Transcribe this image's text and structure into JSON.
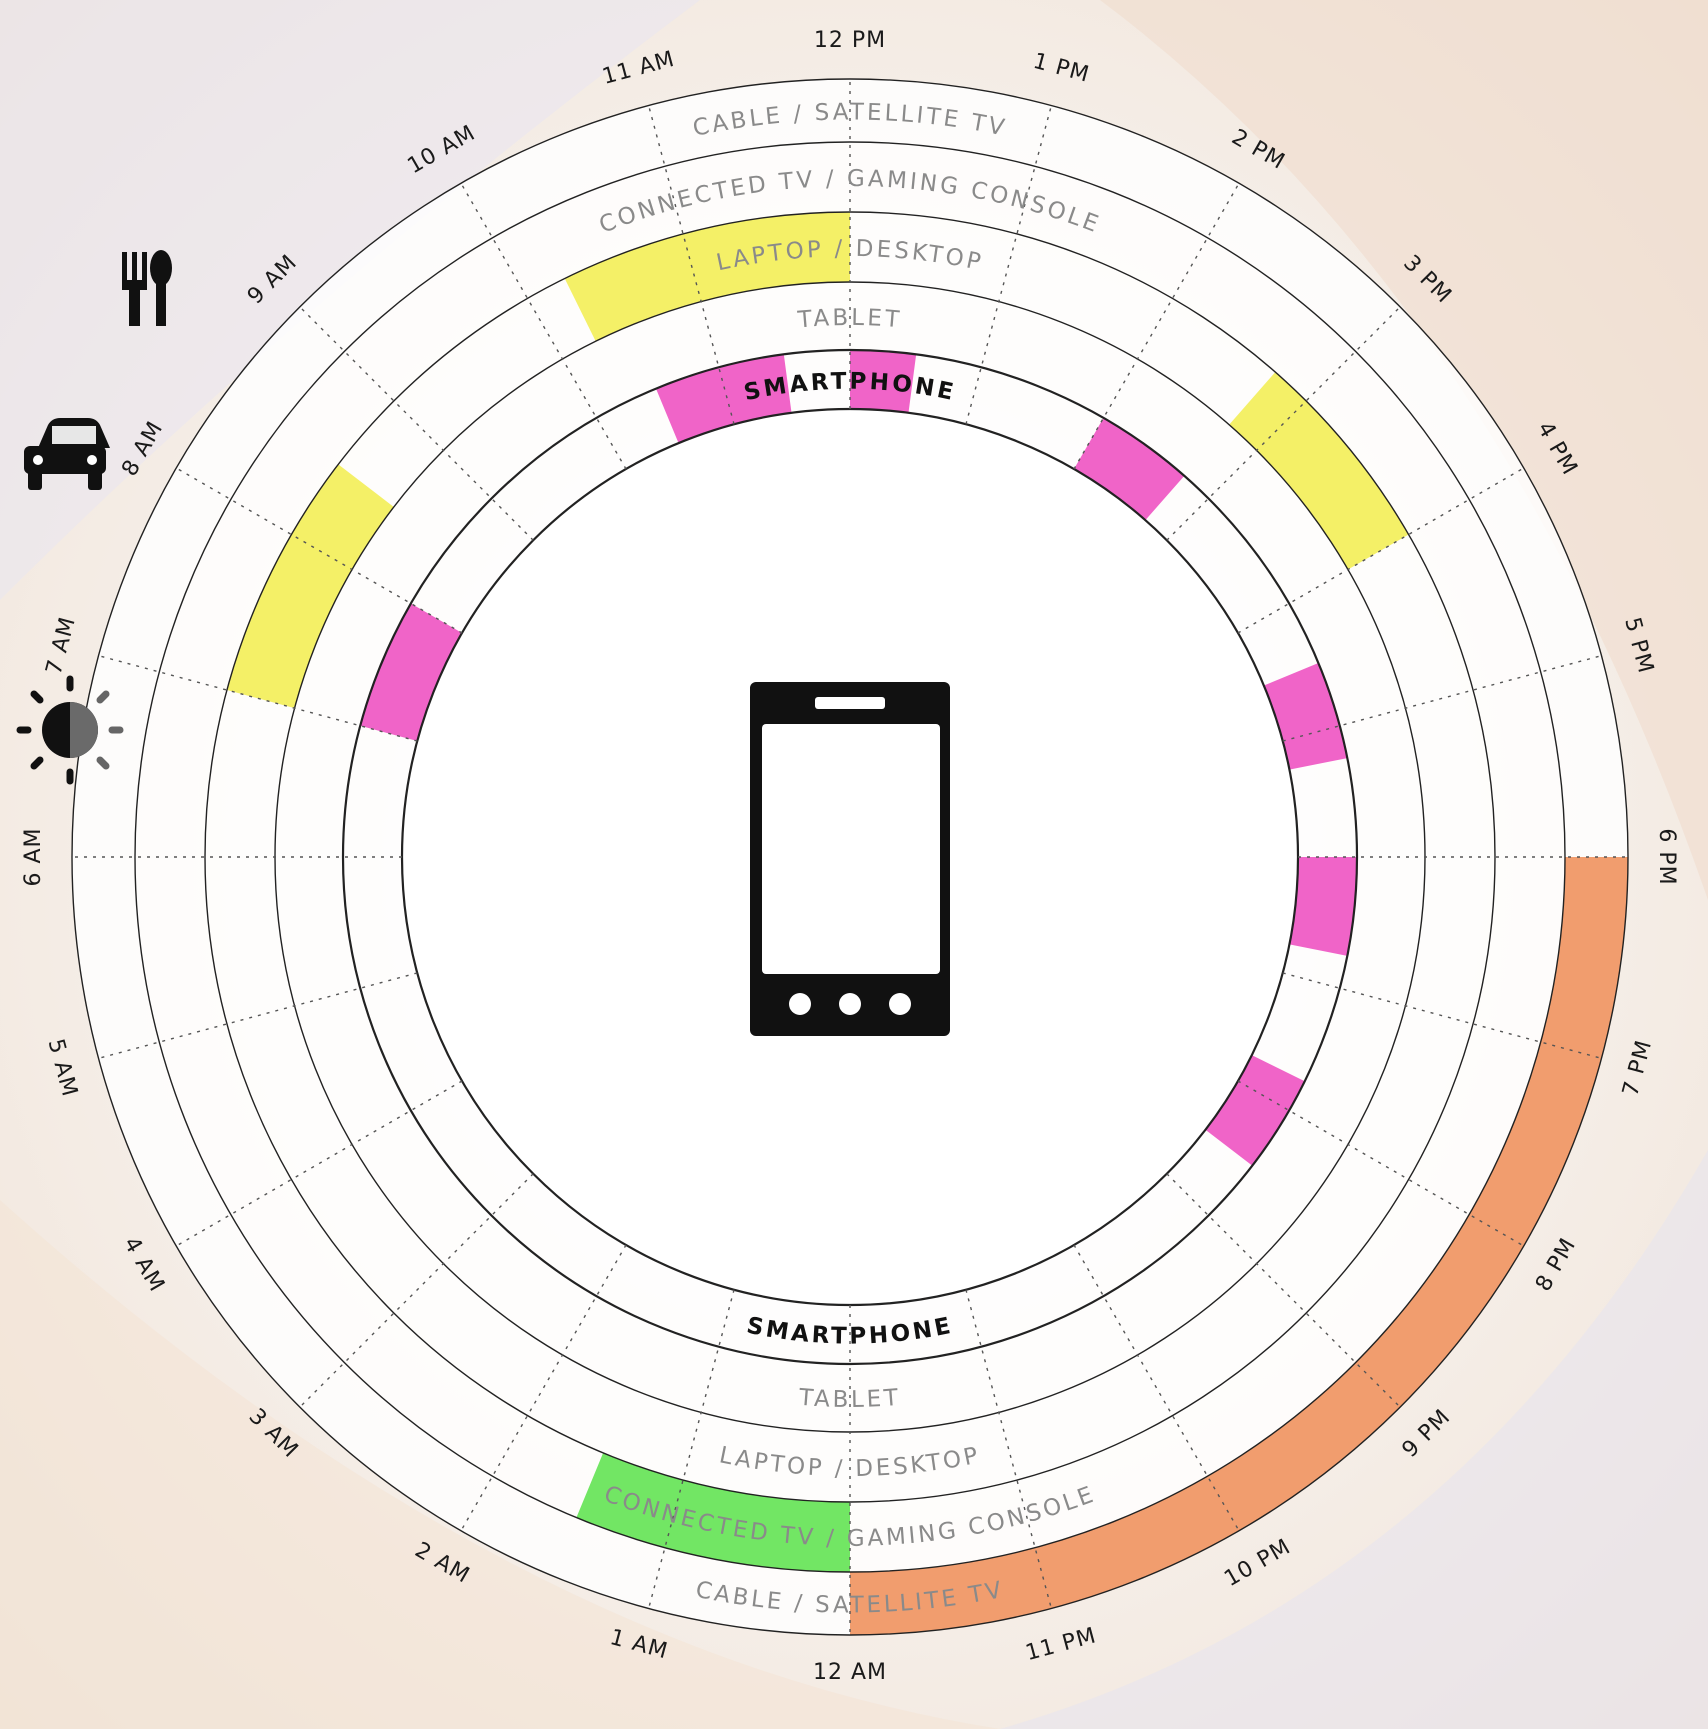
{
  "rings": [
    {
      "key": "cable",
      "label": "CABLE / SATELLITE TV"
    },
    {
      "key": "connected",
      "label": "CONNECTED TV / GAMING CONSOLE"
    },
    {
      "key": "laptop",
      "label": "LAPTOP / DESKTOP"
    },
    {
      "key": "tablet",
      "label": "TABLET"
    },
    {
      "key": "smartphone",
      "label": "SMARTPHONE"
    }
  ],
  "hour_labels": [
    "12 PM",
    "1 PM",
    "2 PM",
    "3 PM",
    "4 PM",
    "5 PM",
    "6 PM",
    "7 PM",
    "8 PM",
    "9 PM",
    "10 PM",
    "11 PM",
    "12 AM",
    "1 AM",
    "2 AM",
    "3 AM",
    "4 AM",
    "5 AM",
    "6 AM",
    "7 AM",
    "8 AM",
    "9 AM",
    "10 AM",
    "11 AM"
  ],
  "center_icon": "smartphone-icon",
  "side_icons": [
    {
      "icon": "fork-spoon-icon",
      "meaning": "meal"
    },
    {
      "icon": "car-icon",
      "meaning": "commute"
    },
    {
      "icon": "sunrise-icon",
      "meaning": "wake up"
    }
  ],
  "colors": {
    "smartphone": "#ee4fc0",
    "laptop": "#f3ee52",
    "connected": "#5ee24f",
    "cable": "#ef8f5a",
    "ring_line": "#222222"
  },
  "usage_blocks": [
    {
      "device": "smartphone",
      "start": "7 AM",
      "end": "8 AM"
    },
    {
      "device": "smartphone",
      "start": "10:30 AM",
      "end": "11:30 AM"
    },
    {
      "device": "smartphone",
      "start": "12 PM",
      "end": "12:30 PM"
    },
    {
      "device": "smartphone",
      "start": "2 PM",
      "end": "2:45 PM"
    },
    {
      "device": "smartphone",
      "start": "4:30 PM",
      "end": "5:15 PM"
    },
    {
      "device": "smartphone",
      "start": "6 PM",
      "end": "6:45 PM"
    },
    {
      "device": "smartphone",
      "start": "7:45 PM",
      "end": "8:30 PM"
    },
    {
      "device": "laptop",
      "start": "7 AM",
      "end": "8:30 AM"
    },
    {
      "device": "laptop",
      "start": "10:15 AM",
      "end": "12 PM"
    },
    {
      "device": "laptop",
      "start": "2:45 PM",
      "end": "4 PM"
    },
    {
      "device": "cable",
      "start": "6 PM",
      "end": "12 AM"
    },
    {
      "device": "connected",
      "start": "12 AM",
      "end": "1:30 AM"
    }
  ]
}
